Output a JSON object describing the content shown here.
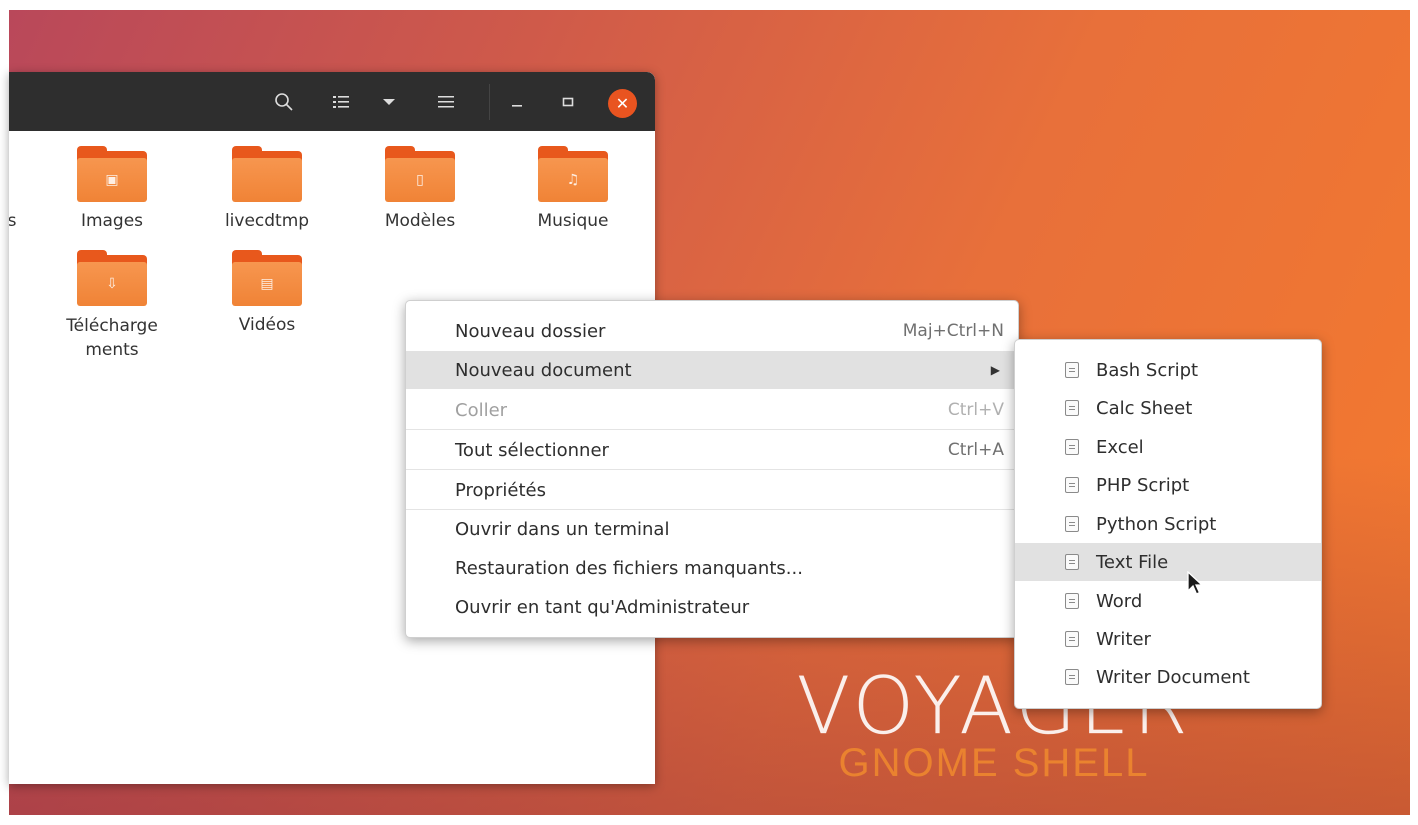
{
  "wallpaper": {
    "brand_title": "VOYAGER",
    "brand_subtitle": "GNOME SHELL"
  },
  "headerbar": {
    "icons": [
      "search-icon",
      "list-view-icon",
      "sort-dropdown-icon",
      "hamburger-menu-icon",
      "minimize-icon",
      "maximize-icon",
      "close-icon"
    ]
  },
  "files": [
    {
      "label": "s",
      "partial": true
    },
    {
      "label": "Images",
      "icon": "image-icon"
    },
    {
      "label": "livecdtmp",
      "icon": "folder-icon"
    },
    {
      "label": "Modèles",
      "icon": "templates-icon"
    },
    {
      "label": "Musique",
      "icon": "music-icon"
    },
    {
      "label": "Télécharge\nments",
      "icon": "download-icon"
    },
    {
      "label": "Vidéos",
      "icon": "video-icon"
    }
  ],
  "context_menu": {
    "items": [
      {
        "label": "Nouveau dossier",
        "accel": "Maj+Ctrl+N"
      },
      {
        "label": "Nouveau document",
        "accel": ""
      },
      {
        "label": "Coller",
        "accel": "Ctrl+V"
      },
      {
        "label": "Tout sélectionner",
        "accel": "Ctrl+A"
      },
      {
        "label": "Propriétés",
        "accel": ""
      },
      {
        "label": "Ouvrir dans un terminal",
        "accel": ""
      },
      {
        "label": "Restauration des fichiers manquants...",
        "accel": ""
      },
      {
        "label": "Ouvrir en tant qu'Administrateur",
        "accel": ""
      }
    ]
  },
  "submenu": {
    "items": [
      {
        "label": "Bash Script"
      },
      {
        "label": "Calc Sheet"
      },
      {
        "label": "Excel"
      },
      {
        "label": "PHP Script"
      },
      {
        "label": "Python Script"
      },
      {
        "label": "Text File"
      },
      {
        "label": "Word"
      },
      {
        "label": "Writer"
      },
      {
        "label": "Writer Document"
      }
    ]
  },
  "colors": {
    "accent": "#e95420",
    "folder": "#f08336",
    "headerbar": "#2e2e2e",
    "highlight": "#e1e1e1"
  }
}
